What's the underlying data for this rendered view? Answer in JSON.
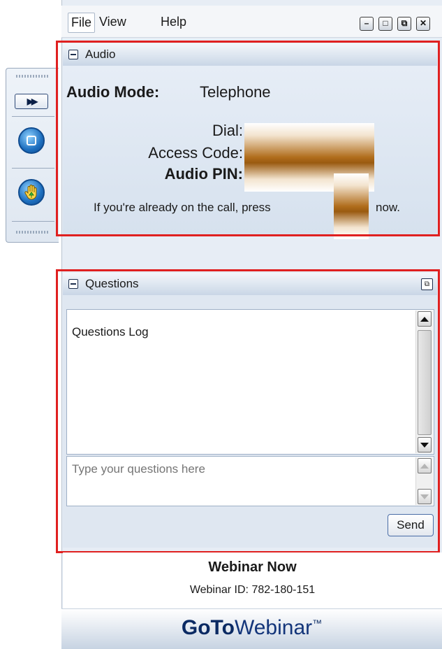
{
  "menu": {
    "file": "File",
    "view": "View",
    "help": "Help"
  },
  "window_controls": {
    "minimize": "–",
    "maximize": "□",
    "restore": "⧉",
    "close": "✕"
  },
  "audio": {
    "header": "Audio",
    "mode_label": "Audio Mode:",
    "mode_value": "Telephone",
    "dial_label": "Dial:",
    "access_code_label": "Access Code:",
    "audio_pin_label": "Audio PIN:",
    "press_text_before": "If you're already on the call, press",
    "press_text_after": "now."
  },
  "questions": {
    "header": "Questions",
    "log_title": "Questions Log",
    "input_placeholder": "Type your questions here",
    "send_label": "Send"
  },
  "footer": {
    "webinar_name": "Webinar Now",
    "webinar_id": "Webinar ID: 782-180-151",
    "brand_goto": "GoTo",
    "brand_rest": "Webinar",
    "brand_tm": "™"
  },
  "icons": {
    "fast_forward": "fast-forward-icon",
    "stop": "stop-icon",
    "raise_hand": "raise-hand-icon"
  },
  "colors": {
    "highlight": "#e02020",
    "brand": "#0b2a63"
  }
}
